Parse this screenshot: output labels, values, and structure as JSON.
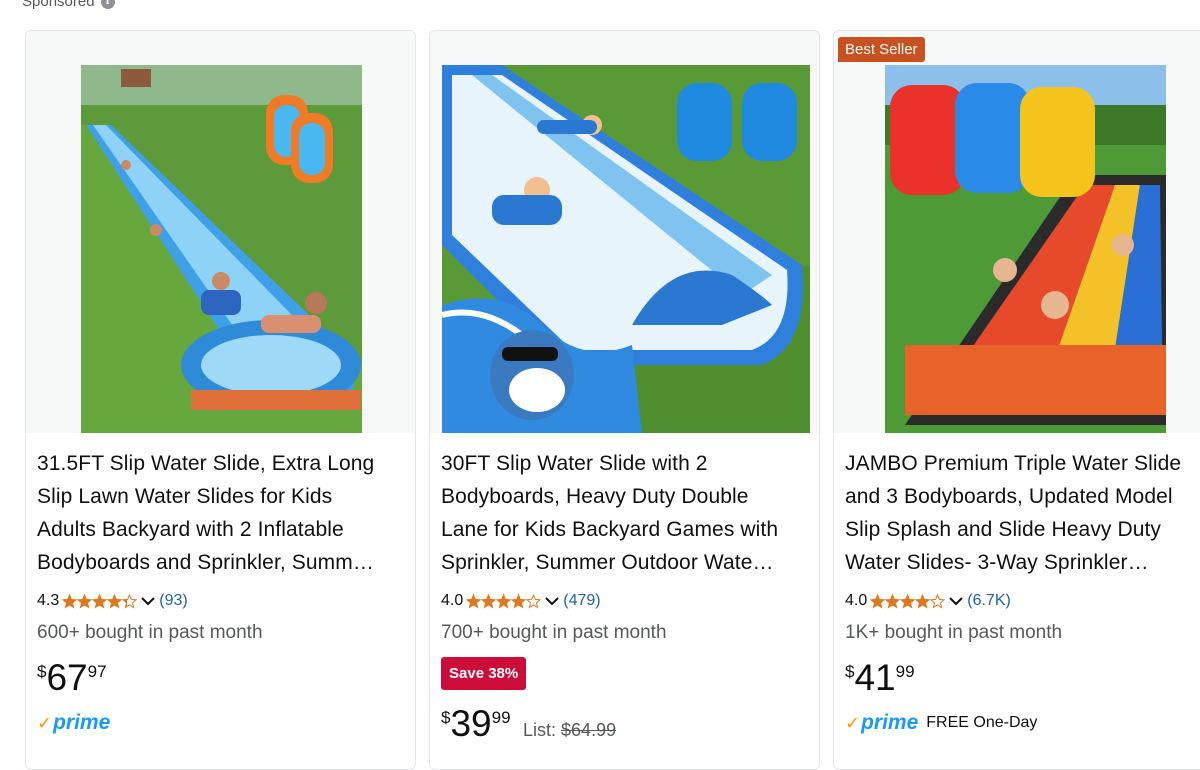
{
  "sponsored": {
    "label": "Sponsored",
    "info_icon": "i"
  },
  "products": [
    {
      "title_lines": [
        "31.5FT Slip Water Slide, Extra Long",
        "Slip Lawn Water Slides for Kids",
        "Adults Backyard with 2 Inflatable",
        "Bodyboards and Sprinkler, Summ…"
      ],
      "rating": "4.3",
      "stars": 4.3,
      "review_count": "(93)",
      "bought": "600+ bought in past month",
      "price_symbol": "$",
      "price_whole": "67",
      "price_fraction": "97",
      "prime": "prime"
    },
    {
      "title_lines": [
        "30FT Slip Water Slide with 2",
        "Bodyboards, Heavy Duty Double",
        "Lane for Kids Backyard Games with",
        "Sprinkler, Summer Outdoor Wate…"
      ],
      "rating": "4.0",
      "stars": 4.0,
      "review_count": "(479)",
      "bought": "700+ bought in past month",
      "save_badge": "Save 38%",
      "price_symbol": "$",
      "price_whole": "39",
      "price_fraction": "99",
      "list_label": "List:",
      "list_price": "$64.99"
    },
    {
      "badge": "Best Seller",
      "title_lines": [
        "JAMBO Premium Triple Water Slide",
        "and 3 Bodyboards, Updated Model",
        "Slip Splash and Slide Heavy Duty",
        "Water Slides- 3-Way Sprinkler…"
      ],
      "rating": "4.0",
      "stars": 4.0,
      "review_count": "(6.7K)",
      "bought": "1K+ bought in past month",
      "price_symbol": "$",
      "price_whole": "41",
      "price_fraction": "99",
      "prime": "prime",
      "delivery": "FREE One-Day"
    }
  ],
  "colors": {
    "star": "#de7921",
    "link": "#2162a1",
    "badge": "#c7511f",
    "save": "#cc0c39",
    "prime": "#1a98ff"
  }
}
